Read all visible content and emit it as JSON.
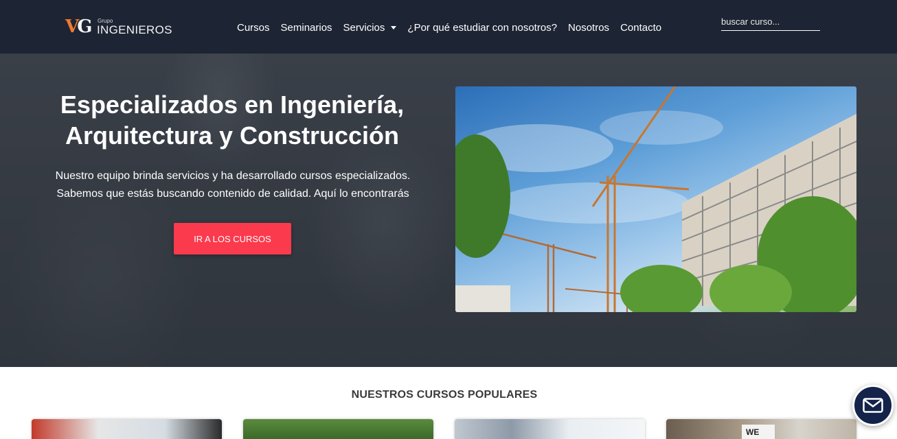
{
  "navbar": {
    "logo": {
      "grupo": "Grupo",
      "brand": "INGENIEROS",
      "mark_v": "V",
      "mark_g": "G"
    },
    "links": [
      {
        "label": "Cursos"
      },
      {
        "label": "Seminarios"
      },
      {
        "label": "Servicios"
      },
      {
        "label": "¿Por qué estudiar con nosotros?"
      },
      {
        "label": "Nosotros"
      },
      {
        "label": "Contacto"
      }
    ],
    "search": {
      "placeholder": "buscar curso...",
      "value": ""
    }
  },
  "hero": {
    "title_line1": "Especializados en Ingeniería,",
    "title_line2": "Arquitectura y Construcción",
    "text": "Nuestro equipo brinda servicios y ha desarrollado cursos especializados. Sabemos que estás buscando contenido de calidad. Aquí lo encontrarás",
    "button_label": "IR A LOS CURSOS",
    "image": "construction-cranes-photo"
  },
  "popular": {
    "title": "NUESTROS CURSOS POPULARES",
    "cards": [
      {
        "image": "blueprints-photo"
      },
      {
        "image": "landscape-photo"
      },
      {
        "image": "classroom-photo"
      },
      {
        "image": "building-photo",
        "sign_text": "WE"
      }
    ]
  },
  "fab": {
    "icon": "mail-icon"
  },
  "colors": {
    "navbar_bg": "#1d2433",
    "accent_red": "#fb3a4d",
    "logo_orange": "#f07a2d",
    "fab_bg": "#13234a"
  }
}
